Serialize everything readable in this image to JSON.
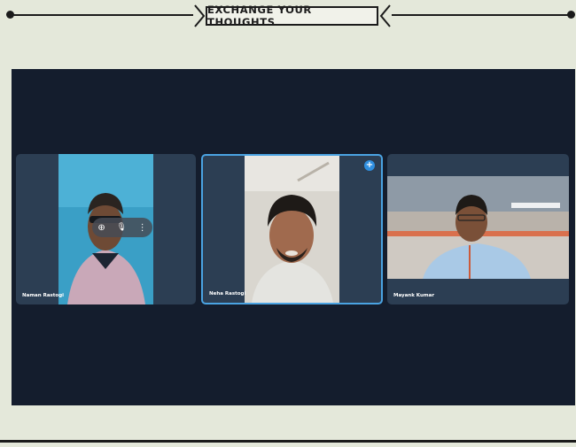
{
  "banner": {
    "title": "EXCHANGE YOUR THOUGHTS"
  },
  "participants": [
    {
      "name": "Naman Rastogi",
      "shirt_color": "#c9a8b8",
      "bg_color": "#3a9fc6"
    },
    {
      "name": "Neha Rastogi",
      "shirt_color": "#e4e4e0",
      "bg_color": "#d9d6cf",
      "pinned": true
    },
    {
      "name": "Mayank Kumar",
      "shirt_color": "#a9c9e6",
      "bg_color": "#b9b2aa"
    }
  ],
  "controls": {
    "pin_icon": "⊕",
    "mic_icon": "🎙",
    "more_icon": "⋮"
  },
  "colors": {
    "stage": "#141d2d",
    "tile": "#2c3e53",
    "active_border": "#4aa3e2",
    "page_bg": "#e4e8da"
  }
}
